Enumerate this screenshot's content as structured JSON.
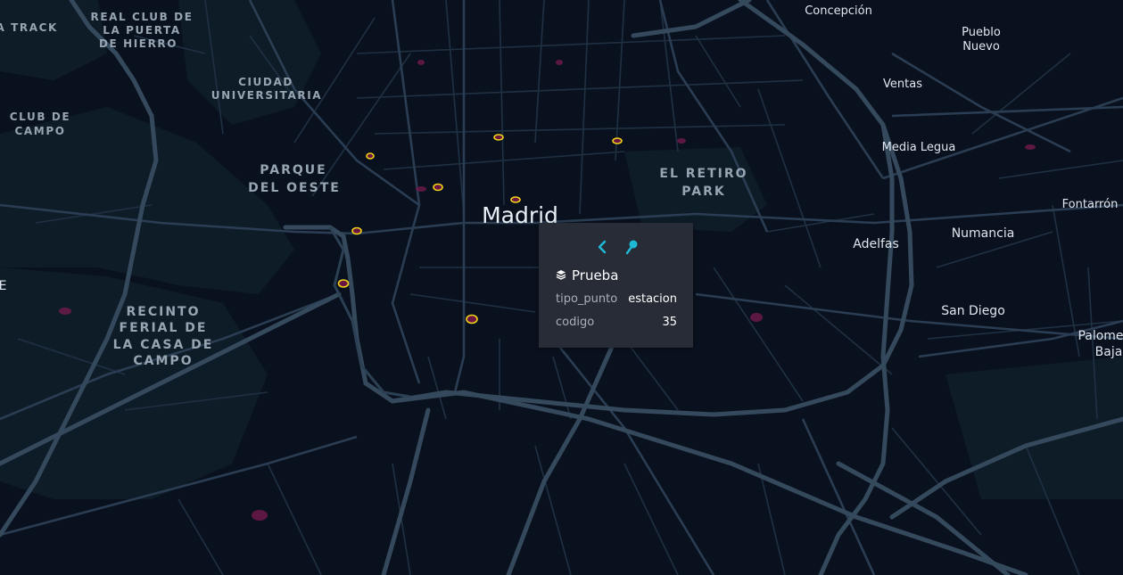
{
  "map": {
    "colors": {
      "background": "#0a111e",
      "park": "#0f1e2a",
      "road": "#24364a",
      "highway": "#3a5063",
      "point_fill": "#6b1542",
      "point_stroke": "#f0d218",
      "heat": "#6b1a4a"
    },
    "city_label": "Madrid",
    "labels": {
      "track": "UELA TRACK",
      "real_club_1": "REAL CLUB DE",
      "real_club_2": "LA PUERTA",
      "real_club_3": "DE HIERRO",
      "ciudad_1": "CIUDAD",
      "ciudad_2": "UNIVERSITARIA",
      "club_campo_1": "CLUB DE",
      "club_campo_2": "CAMPO",
      "parque_1": "PARQUE",
      "parque_2": "DEL OESTE",
      "retiro_1": "EL RETIRO",
      "retiro_2": "PARK",
      "recinto_1": "RECINTO",
      "recinto_2": "FERIAL DE",
      "recinto_3": "LA CASA DE",
      "recinto_4": "CAMPO",
      "concepcion": "Concepción",
      "pueblo_1": "Pueblo",
      "pueblo_2": "Nuevo",
      "ventas": "Ventas",
      "media_legua": "Media Legua",
      "fontarron": "Fontarrón",
      "adelfas": "Adelfas",
      "numancia": "Numancia",
      "san_diego": "San Diego",
      "palomeras_1": "Palome",
      "palomeras_2": "Baja",
      "edge_e": "E"
    }
  },
  "popup": {
    "back_icon": "chevron-left-icon",
    "pin_icon": "pin-icon",
    "layer_icon": "layers-icon",
    "layer_name": "Prueba",
    "fields": [
      {
        "key": "tipo_punto",
        "value": "estacion"
      },
      {
        "key": "codigo",
        "value": "35"
      }
    ]
  }
}
